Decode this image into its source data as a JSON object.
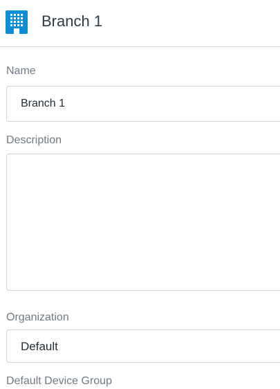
{
  "header": {
    "title": "Branch 1",
    "icon": "building-icon",
    "icon_color": "#0a8fd6"
  },
  "form": {
    "name": {
      "label": "Name",
      "value": "Branch 1"
    },
    "description": {
      "label": "Description",
      "value": ""
    },
    "organization": {
      "label": "Organization",
      "value": "Default"
    },
    "default_device_group": {
      "label": "Default Device Group"
    }
  }
}
